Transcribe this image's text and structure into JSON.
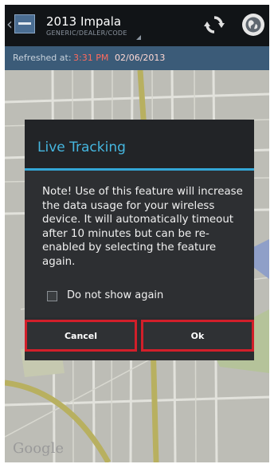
{
  "app": {
    "title": "2013 Impala",
    "subtitle": "GENERIC/DEALER/CODE",
    "icons": [
      "back-caret-icon",
      "app-icon",
      "refresh-icon",
      "globe-icon"
    ]
  },
  "refresh_bar": {
    "label": "Refreshed at:",
    "time": "3:31 PM",
    "date": "02/06/2013"
  },
  "map": {
    "attribution": "Google"
  },
  "dialog": {
    "title": "Live Tracking",
    "message": "Note! Use of this feature will increase the data usage for your wireless device. It will automatically timeout after 10 minutes but can be re-enabled by selecting the feature again.",
    "checkbox_label": "Do not show again",
    "checkbox_checked": false,
    "cancel_label": "Cancel",
    "ok_label": "Ok",
    "accent_color": "#34a6d6",
    "highlight_color": "#d21f2a"
  }
}
